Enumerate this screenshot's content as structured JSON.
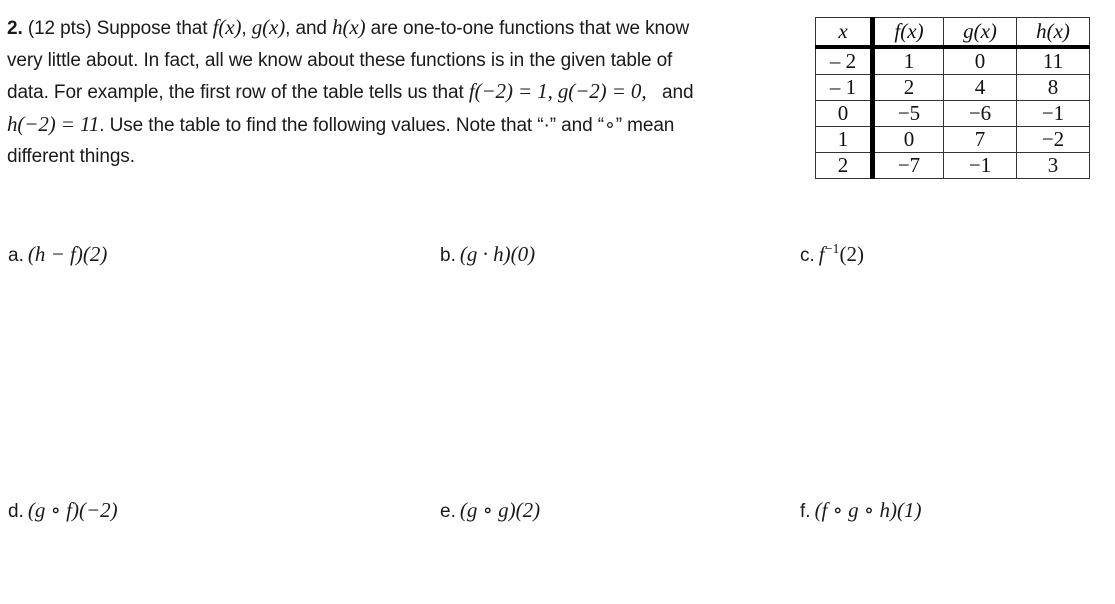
{
  "problem": {
    "number": "2.",
    "points": "(12 pts)",
    "lines": [
      {
        "segments": [
          {
            "t": "text",
            "v": " Suppose that "
          },
          {
            "t": "math",
            "v": "f(x)"
          },
          {
            "t": "text",
            "v": ", "
          },
          {
            "t": "math",
            "v": "g(x)"
          },
          {
            "t": "text",
            "v": ", and "
          },
          {
            "t": "math",
            "v": "h(x)"
          },
          {
            "t": "text",
            "v": " are one-to-one functions that we know"
          }
        ]
      },
      {
        "segments": [
          {
            "t": "text",
            "v": "very little about.  In fact, all we know about these functions is in the given table of"
          }
        ]
      },
      {
        "segments": [
          {
            "t": "text",
            "v": "data.  For example, the first row of the table tells us that "
          },
          {
            "t": "math",
            "v": "f(−2) = 1, g(−2) = 0,"
          },
          {
            "t": "text",
            "v": "   and"
          }
        ]
      },
      {
        "segments": [
          {
            "t": "math",
            "v": "h(−2) = 11"
          },
          {
            "t": "text",
            "v": ". Use the table to find the following values. Note that “·” and “∘” mean"
          }
        ]
      },
      {
        "segments": [
          {
            "t": "text",
            "v": "different things."
          }
        ]
      }
    ]
  },
  "table": {
    "headers": [
      "x",
      "f(x)",
      "g(x)",
      "h(x)"
    ],
    "rows": [
      [
        "– 2",
        "1",
        "0",
        "11"
      ],
      [
        "– 1",
        "2",
        "4",
        "8"
      ],
      [
        "0",
        "−5",
        "−6",
        "−1"
      ],
      [
        "1",
        "0",
        "7",
        "−2"
      ],
      [
        "2",
        "−7",
        "−1",
        "3"
      ]
    ]
  },
  "questions": [
    {
      "label": "a.",
      "expr": "(h − f)(2)"
    },
    {
      "label": "b.",
      "expr": "(g · h)(0)"
    },
    {
      "label": "c.",
      "expr_base": "f",
      "expr_sup": "−1",
      "expr_tail": "(2)"
    },
    {
      "label": "d.",
      "expr": "(g ∘ f)(−2)"
    },
    {
      "label": "e.",
      "expr": "(g ∘ g)(2)"
    },
    {
      "label": "f.",
      "expr": "(f ∘ g ∘ h)(1)"
    }
  ]
}
